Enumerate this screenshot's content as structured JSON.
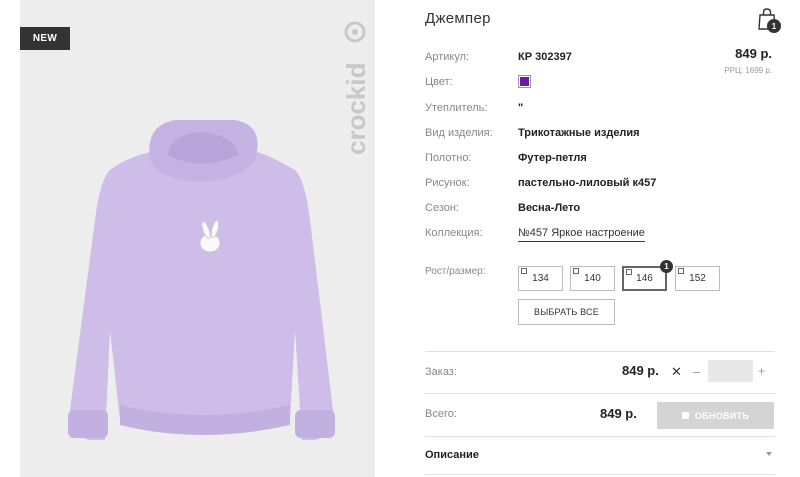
{
  "product": {
    "badge": "NEW",
    "brand": "crockid",
    "title": "Джемпер",
    "cart_count": "1",
    "price": "849 р.",
    "rrp": "РРЦ: 1699 р.",
    "color_hex": "#6a1aa8",
    "attributes": [
      {
        "label": "Артикул:",
        "value": "КР 302397"
      },
      {
        "label": "Цвет:",
        "value": ""
      },
      {
        "label": "Утеплитель:",
        "value": "\""
      },
      {
        "label": "Вид изделия:",
        "value": "Трикотажные изделия"
      },
      {
        "label": "Полотно:",
        "value": "Футер-петля"
      },
      {
        "label": "Рисунок:",
        "value": "пастельно-лиловый к457"
      },
      {
        "label": "Сезон:",
        "value": "Весна-Лето"
      },
      {
        "label": "Коллекция:",
        "value": "№457 Яркое настроение"
      }
    ]
  },
  "sizes": {
    "label": "Рост/размер:",
    "options": [
      "134",
      "140",
      "146",
      "152"
    ],
    "selected_index": 2,
    "selected_count": "1",
    "select_all": "ВЫБРАТЬ ВСЕ"
  },
  "order": {
    "label": "Заказ:",
    "price": "849 р.",
    "times": "✕",
    "minus": "–",
    "plus": "+",
    "qty": ""
  },
  "total": {
    "label": "Всего:",
    "price": "849 р.",
    "button": "ОБНОВИТЬ"
  },
  "description": {
    "label": "Описание"
  }
}
